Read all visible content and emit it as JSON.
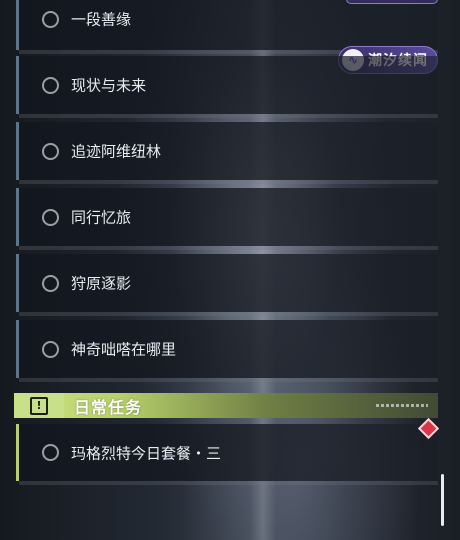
{
  "badge": {
    "icon": "wave-logo-icon",
    "label": "潮汐续闻"
  },
  "quests": [
    {
      "label": "一段善缘"
    },
    {
      "label": "现状与未来"
    },
    {
      "label": "追迹阿维纽林"
    },
    {
      "label": "同行忆旅"
    },
    {
      "label": "狩原逐影"
    },
    {
      "label": "神奇咄嗒在哪里"
    }
  ],
  "daily": {
    "title": "日常任务",
    "icon": "alert-icon",
    "items": [
      {
        "label": "玛格烈特今日套餐・三"
      }
    ]
  },
  "colors": {
    "quest_accent": "#5e7589",
    "daily_accent": "#c9e08a",
    "badge_bg": "#4a3c85",
    "alert_diamond": "#e0334b"
  }
}
